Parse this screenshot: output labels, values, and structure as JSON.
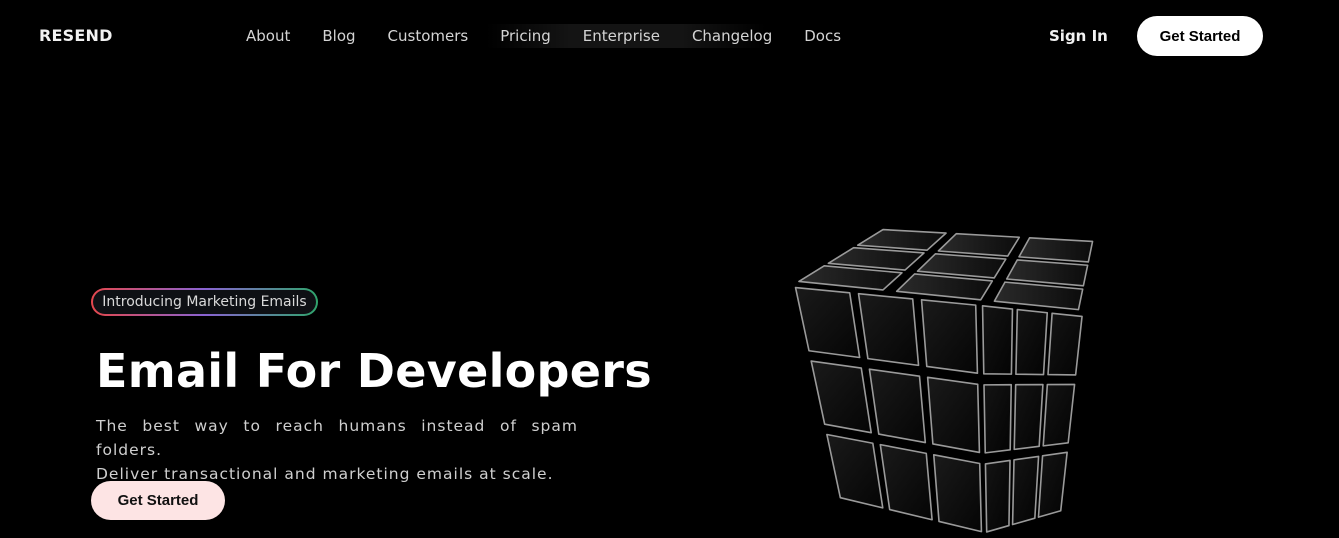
{
  "nav": {
    "logo": "RESEND",
    "links": [
      "About",
      "Blog",
      "Customers",
      "Pricing",
      "Enterprise",
      "Changelog",
      "Docs"
    ],
    "sign_in": "Sign In",
    "cta": "Get Started"
  },
  "hero": {
    "badge": "Introducing Marketing Emails",
    "title": "Email For Developers",
    "subtitle_line1": "The best way to reach humans instead of spam folders.",
    "subtitle_line2": "Deliver transactional and marketing emails at scale.",
    "cta": "Get Started"
  },
  "colors": {
    "background": "#000000",
    "cta_primary": "#ffffff",
    "cta_hero": "#fde4e4",
    "badge_gradient": [
      "#e5484d",
      "#8a63d2",
      "#30a46c"
    ]
  }
}
